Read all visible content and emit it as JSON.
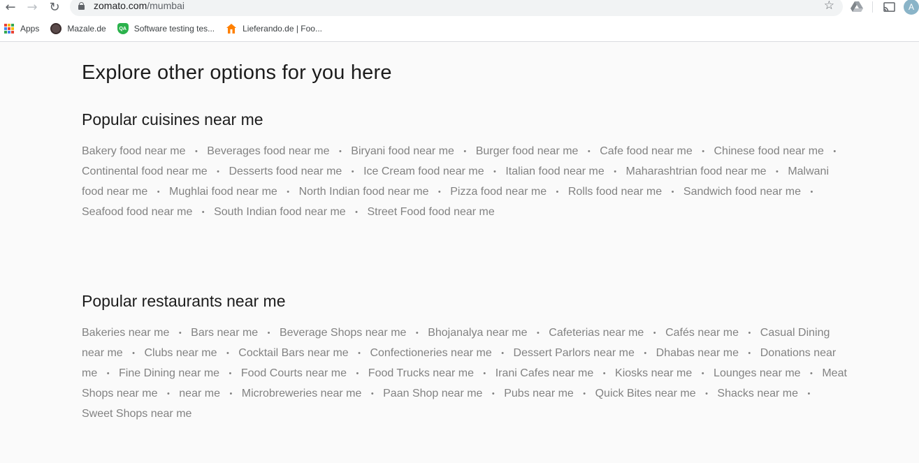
{
  "browser": {
    "url_host": "zomato.com",
    "url_path": "/mumbai",
    "avatar_letter": "A",
    "bookmarks": [
      {
        "label": "Apps",
        "icon": "apps-grid-icon"
      },
      {
        "label": "Mazale.de",
        "icon": "mazale-favicon"
      },
      {
        "label": "Software testing tes...",
        "icon": "qa-shield-favicon"
      },
      {
        "label": "Lieferando.de | Foo...",
        "icon": "lieferando-house-favicon"
      }
    ]
  },
  "page": {
    "main_title": "Explore other options for you here",
    "cuisines": {
      "title": "Popular cuisines near me",
      "links": [
        "Bakery food near me",
        "Beverages food near me",
        "Biryani food near me",
        "Burger food near me",
        "Cafe food near me",
        "Chinese food near me",
        "Continental food near me",
        "Desserts food near me",
        "Ice Cream food near me",
        "Italian food near me",
        "Maharashtrian food near me",
        "Malwani food near me",
        "Mughlai food near me",
        "North Indian food near me",
        "Pizza food near me",
        "Rolls food near me",
        "Sandwich food near me",
        "Seafood food near me",
        "South Indian food near me",
        "Street Food food near me"
      ]
    },
    "restaurants": {
      "title": "Popular restaurants near me",
      "links": [
        "Bakeries near me",
        "Bars near me",
        "Beverage Shops near me",
        "Bhojanalya near me",
        "Cafeterias near me",
        "Cafés near me",
        "Casual Dining near me",
        "Clubs near me",
        "Cocktail Bars near me",
        "Confectioneries near me",
        "Dessert Parlors near me",
        "Dhabas near me",
        "Donations near me",
        "Fine Dining near me",
        "Food Courts near me",
        "Food Trucks near me",
        "Irani Cafes near me",
        "Kiosks near me",
        "Lounges near me",
        "Meat Shops near me",
        " near me",
        "Microbreweries near me",
        "Paan Shop near me",
        "Pubs near me",
        "Quick Bites near me",
        "Shacks near me",
        "Sweet Shops near me"
      ]
    }
  },
  "colors": {
    "page_bg": "#fafafa",
    "heading": "#1c1c1c",
    "link": "#828282",
    "omnibox_bg": "#f1f3f4"
  }
}
